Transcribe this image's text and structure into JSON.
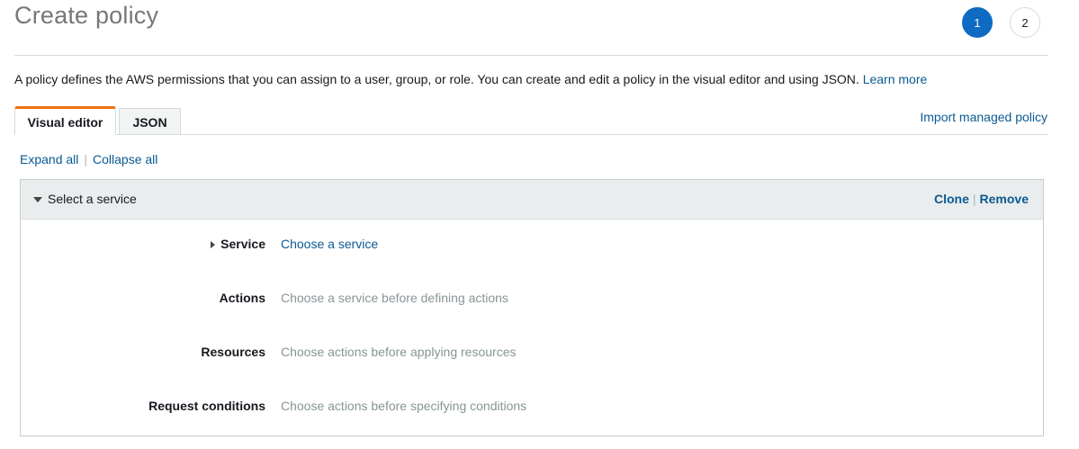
{
  "header": {
    "title": "Create policy",
    "steps": [
      "1",
      "2"
    ]
  },
  "description": {
    "text": "A policy defines the AWS permissions that you can assign to a user, group, or role. You can create and edit a policy in the visual editor and using JSON. ",
    "learn_more": "Learn more"
  },
  "tabs": [
    {
      "label": "Visual editor",
      "active": true
    },
    {
      "label": "JSON",
      "active": false
    }
  ],
  "import_link": "Import managed policy",
  "expand_all": "Expand all",
  "collapse_all": "Collapse all",
  "panel": {
    "title": "Select a service",
    "clone": "Clone",
    "remove": "Remove",
    "rows": [
      {
        "label": "Service",
        "value": "Choose a service"
      },
      {
        "label": "Actions",
        "value": "Choose a service before defining actions"
      },
      {
        "label": "Resources",
        "value": "Choose actions before applying resources"
      },
      {
        "label": "Request conditions",
        "value": "Choose actions before specifying conditions"
      }
    ]
  },
  "colors": {
    "accent": "#0f6bc2",
    "link": "#0a5a93",
    "tab_indicator": "#ec7211",
    "muted": "#879596"
  },
  "icons": {
    "panel_toggle": "caret-down-icon",
    "service_toggle": "caret-right-icon"
  }
}
